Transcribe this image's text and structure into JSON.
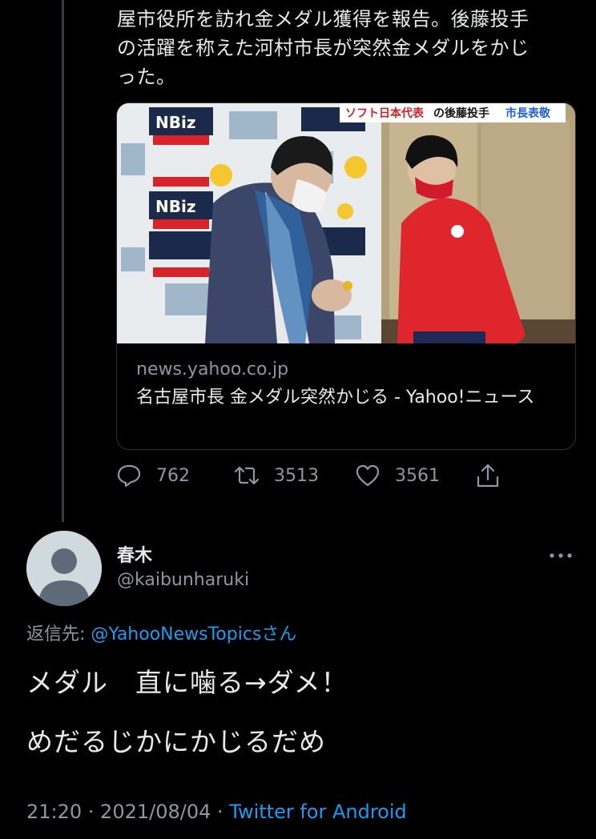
{
  "parent_tweet": {
    "text_lines": [
      "屋市役所を訪れ金メダル獲得を報告。後藤投手",
      "の活躍を称えた河村市長が突然金メダルをかじ",
      "った。"
    ],
    "card": {
      "media_banner_part1": "ソフト日本代表",
      "media_banner_part2": "の後藤投手",
      "media_banner_part3": "市長表敬",
      "backdrop_logo": "NBiz",
      "domain": "news.yahoo.co.jp",
      "title": "名古屋市長 金メダル突然かじる - Yahoo!ニュース"
    },
    "actions": {
      "reply_count": "762",
      "retweet_count": "3513",
      "like_count": "3561"
    }
  },
  "reply_tweet": {
    "display_name": "春木",
    "handle": "@kaibunharuki",
    "reply_to_prefix": "返信先: ",
    "reply_to_mention": "@YahooNewsTopics",
    "reply_to_suffix": "さん",
    "line1": "メダル　直に噛る→ダメ！",
    "line2": "めだるじかにかじるだめ",
    "timestamp": "21:20 · 2021/08/04 · ",
    "source": "Twitter for Android"
  },
  "colors": {
    "background": "#000000",
    "text": "#e7e9ea",
    "secondary": "#8b98a5",
    "accent": "#1d9bf0"
  }
}
